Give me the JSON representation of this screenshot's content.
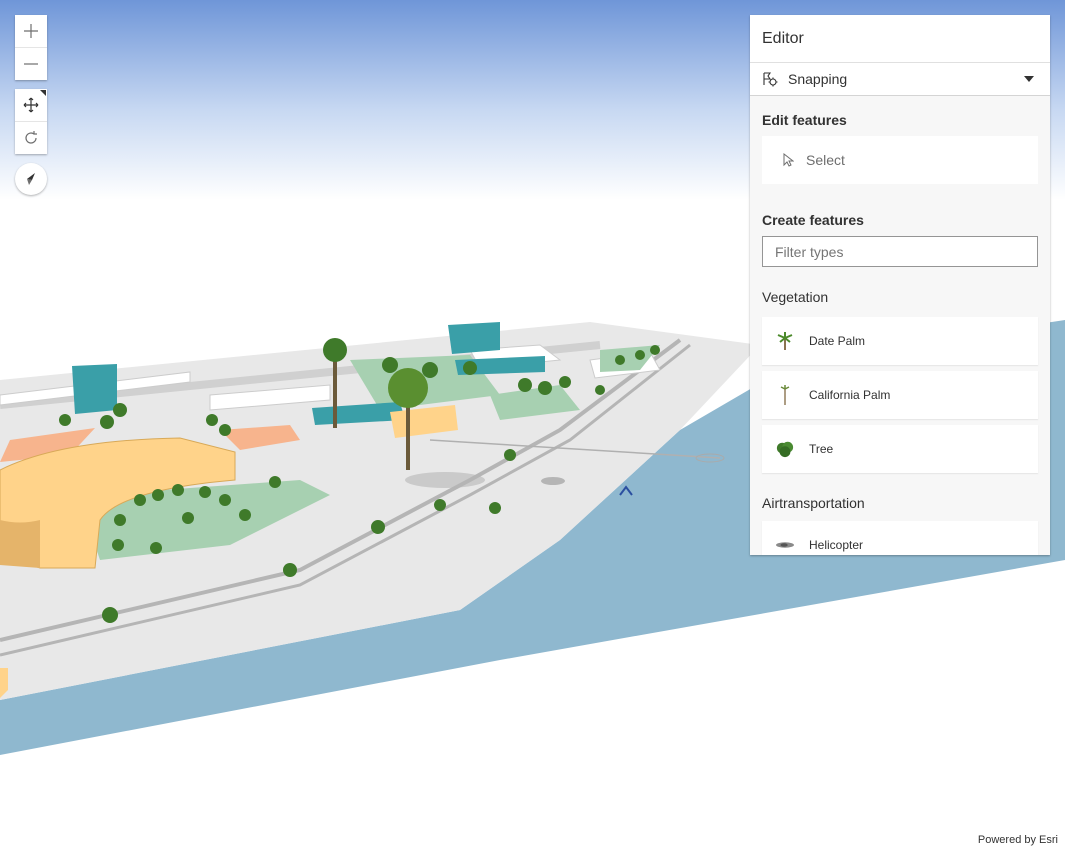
{
  "nav": {
    "zoom_in_icon": "plus-icon",
    "zoom_out_icon": "minus-icon",
    "pan_icon": "pan-arrows-icon",
    "rotate_icon": "rotate-icon",
    "compass_icon": "compass-icon"
  },
  "editor": {
    "title": "Editor",
    "snapping": {
      "label": "Snapping",
      "icon": "snapping-icon"
    },
    "edit_features": {
      "title": "Edit features",
      "select_label": "Select",
      "select_icon": "cursor-icon"
    },
    "create_features": {
      "title": "Create features",
      "filter_placeholder": "Filter types",
      "groups": [
        {
          "title": "Vegetation",
          "items": [
            {
              "label": "Date Palm",
              "icon": "date-palm-icon"
            },
            {
              "label": "California Palm",
              "icon": "california-palm-icon"
            },
            {
              "label": "Tree",
              "icon": "tree-icon"
            }
          ]
        },
        {
          "title": "Airtransportation",
          "items": [
            {
              "label": "Helicopter",
              "icon": "helicopter-icon"
            }
          ]
        }
      ]
    }
  },
  "attribution": "Powered by Esri",
  "colors": {
    "sky_top": "#6f96d8",
    "water": "#8fb8cf",
    "land": "#eaeaea",
    "building_teal": "#3a9fa8",
    "building_tan": "#ffd38a"
  }
}
